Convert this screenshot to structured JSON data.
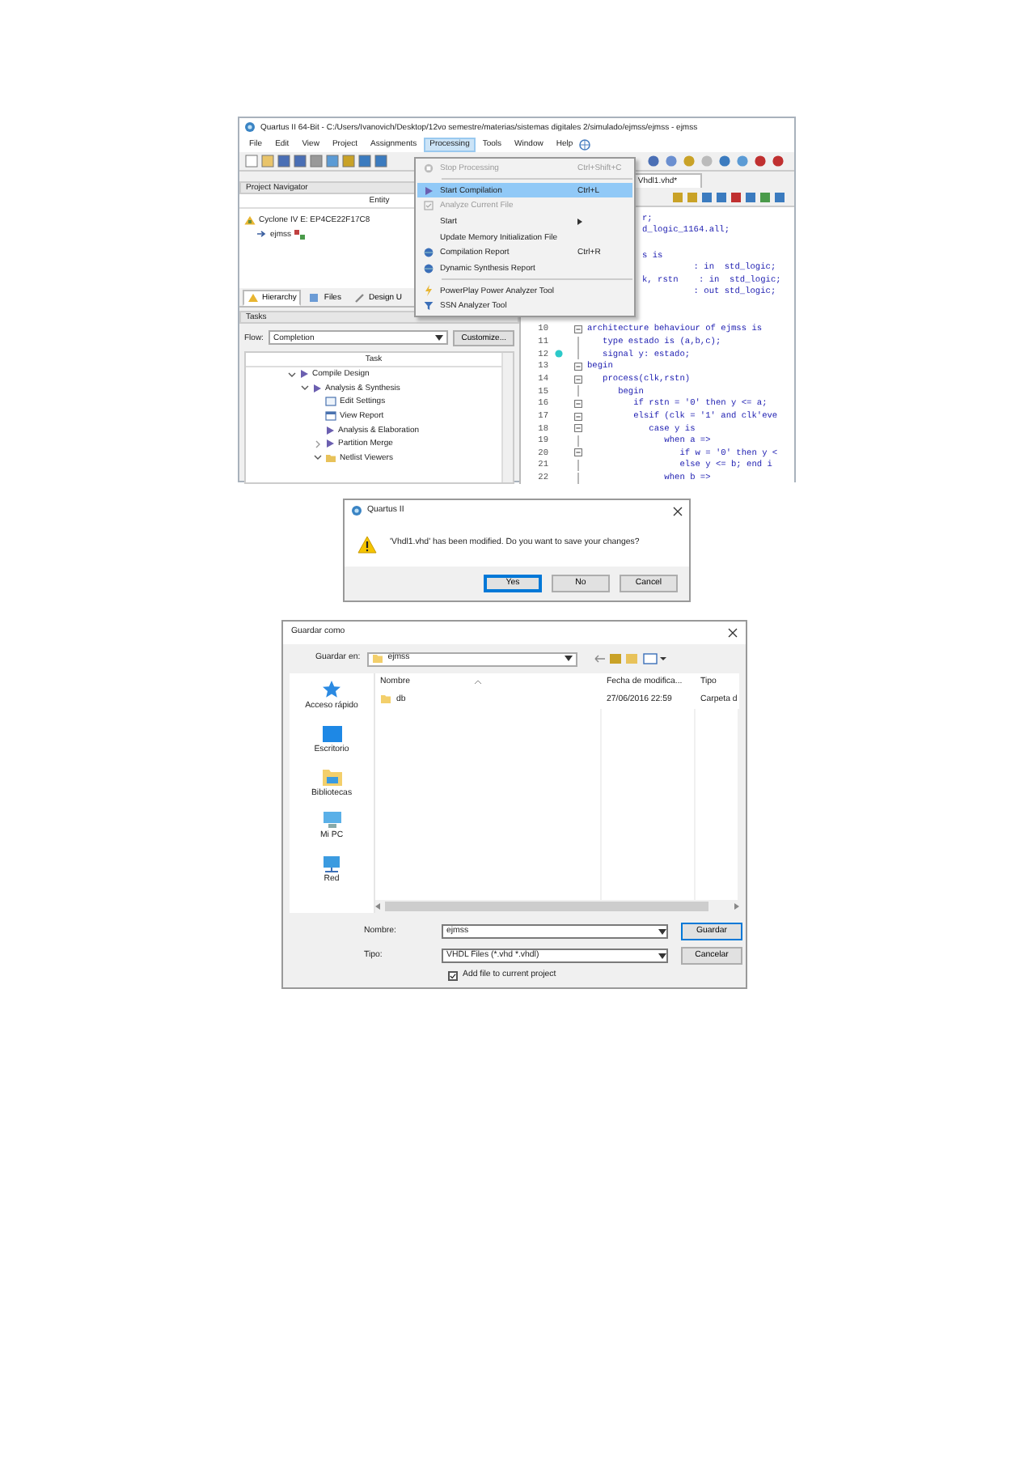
{
  "editor_window": {
    "title": "Quartus II 64-Bit - C:/Users/Ivanovich/Desktop/12vo semestre/materias/sistemas digitales 2/simulado/ejmss/ejmss - ejmss",
    "menu": [
      {
        "label": "File",
        "selected": false
      },
      {
        "label": "Edit",
        "selected": false
      },
      {
        "label": "View",
        "selected": false
      },
      {
        "label": "Project",
        "selected": false
      },
      {
        "label": "Assignments",
        "selected": false
      },
      {
        "label": "Processing",
        "selected": true
      },
      {
        "label": "Tools",
        "selected": false
      },
      {
        "label": "Window",
        "selected": false
      },
      {
        "label": "Help",
        "selected": false
      }
    ],
    "project_navigator": {
      "title": "Project Navigator",
      "column": "Entity",
      "tree": [
        {
          "label": "Cyclone IV E: EP4CE22F17C8",
          "children": [
            {
              "label": "ejmss"
            }
          ]
        }
      ],
      "tabs": [
        {
          "label": "Hierarchy",
          "selected": true
        },
        {
          "label": "Files",
          "selected": false
        },
        {
          "label": "Design U",
          "selected": false
        }
      ]
    },
    "tasks": {
      "title": "Tasks",
      "flow_label": "Flow:",
      "flow_value": "Completion",
      "customize_button": "Customize...",
      "column": "Task",
      "tree": [
        {
          "label": "Compile Design",
          "kind": "run",
          "expanded": true,
          "children": [
            {
              "label": "Analysis & Synthesis",
              "kind": "run",
              "expanded": true,
              "children": [
                {
                  "label": "Edit Settings",
                  "kind": "settings"
                },
                {
                  "label": "View Report",
                  "kind": "report"
                },
                {
                  "label": "Analysis & Elaboration",
                  "kind": "run"
                },
                {
                  "label": "Partition Merge",
                  "kind": "run",
                  "expanded": false
                },
                {
                  "label": "Netlist Viewers",
                  "kind": "folder",
                  "expanded": true
                }
              ]
            }
          ]
        }
      ]
    },
    "editor": {
      "tab": "Vhdl1.vhd*",
      "lines": [
        {
          "kind": "fragment",
          "text": "r;"
        },
        {
          "kind": "fragment",
          "text": "d_logic_1164.all;"
        },
        {
          "kind": "blank"
        },
        {
          "kind": "fragment",
          "text": "s is"
        },
        {
          "kind": "fragment",
          "text": "          : in  std_logic;"
        },
        {
          "kind": "fragment",
          "text": "k, rstn    : in  std_logic;"
        },
        {
          "kind": "fragment",
          "text": "          : out std_logic;"
        },
        {
          "kind": "blank"
        },
        {
          "kind": "blank"
        },
        {
          "kind": "line",
          "number": "10",
          "fold": true,
          "marked": false,
          "text": "architecture behaviour of ejmss is"
        },
        {
          "kind": "line",
          "number": "11",
          "fold": false,
          "marked": false,
          "text": "   type estado is (a,b,c);"
        },
        {
          "kind": "line",
          "number": "12",
          "fold": false,
          "marked": true,
          "text": "   signal y: estado;"
        },
        {
          "kind": "line",
          "number": "13",
          "fold": true,
          "marked": false,
          "text": "begin"
        },
        {
          "kind": "line",
          "number": "14",
          "fold": true,
          "marked": false,
          "text": "   process(clk,rstn)"
        },
        {
          "kind": "line",
          "number": "15",
          "fold": false,
          "marked": false,
          "text": "      begin"
        },
        {
          "kind": "line",
          "number": "16",
          "fold": true,
          "marked": false,
          "text": "         if rstn = '0' then y <= a;"
        },
        {
          "kind": "line",
          "number": "17",
          "fold": true,
          "marked": false,
          "text": "         elsif (clk = '1' and clk'eve"
        },
        {
          "kind": "line",
          "number": "18",
          "fold": true,
          "marked": false,
          "text": "            case y is"
        },
        {
          "kind": "line",
          "number": "19",
          "fold": false,
          "marked": false,
          "text": "               when a =>"
        },
        {
          "kind": "line",
          "number": "20",
          "fold": true,
          "marked": false,
          "text": "                  if w = '0' then y <"
        },
        {
          "kind": "line",
          "number": "21",
          "fold": false,
          "marked": false,
          "text": "                  else y <= b; end i"
        },
        {
          "kind": "line",
          "number": "22",
          "fold": false,
          "marked": false,
          "text": "               when b =>"
        }
      ]
    },
    "processing_menu": [
      {
        "label": "Stop Processing",
        "shortcut": "Ctrl+Shift+C",
        "kind": "stop",
        "disabled": true,
        "selected": false,
        "separator_after": true
      },
      {
        "label": "Start Compilation",
        "shortcut": "Ctrl+L",
        "kind": "compile",
        "disabled": false,
        "selected": true,
        "separator_after": false
      },
      {
        "label": "Analyze Current File",
        "kind": "analyze",
        "disabled": true,
        "selected": false,
        "separator_after": false
      },
      {
        "label": "Start",
        "kind": "submenu",
        "disabled": false,
        "selected": false,
        "separator_after": false
      },
      {
        "label": "Update Memory Initialization File",
        "kind": "plain",
        "disabled": false,
        "selected": false,
        "separator_after": false
      },
      {
        "label": "Compilation Report",
        "shortcut": "Ctrl+R",
        "kind": "report",
        "disabled": false,
        "selected": false,
        "separator_after": false
      },
      {
        "label": "Dynamic Synthesis Report",
        "kind": "report",
        "disabled": false,
        "selected": false,
        "separator_after": true
      },
      {
        "label": "PowerPlay Power Analyzer Tool",
        "kind": "power",
        "disabled": false,
        "selected": false,
        "separator_after": false
      },
      {
        "label": "SSN Analyzer Tool",
        "kind": "ssn",
        "disabled": false,
        "selected": false,
        "separator_after": false
      }
    ]
  },
  "save_prompt": {
    "title": "Quartus II",
    "message": "'Vhdl1.vhd' has been modified. Do you want to save your changes?",
    "buttons": [
      {
        "label": "Yes",
        "default": true
      },
      {
        "label": "No",
        "default": false
      },
      {
        "label": "Cancel",
        "default": false
      }
    ]
  },
  "save_dialog": {
    "title": "Guardar como",
    "save_in_label": "Guardar en:",
    "save_in_value": "ejmss",
    "places": [
      {
        "label": "Acceso rápido",
        "kind": "quick"
      },
      {
        "label": "Escritorio",
        "kind": "desktop"
      },
      {
        "label": "Bibliotecas",
        "kind": "libraries"
      },
      {
        "label": "Mi PC",
        "kind": "pc"
      },
      {
        "label": "Red",
        "kind": "network"
      }
    ],
    "columns": [
      "Nombre",
      "Fecha de modifica...",
      "Tipo"
    ],
    "files": [
      {
        "name": "db",
        "date": "27/06/2016 22:59",
        "type": "Carpeta d"
      }
    ],
    "filename_label": "Nombre:",
    "filename": "ejmss",
    "type_label": "Tipo:",
    "type_value": "VHDL Files (*.vhd *.vhdl)",
    "save_button": "Guardar",
    "cancel_button": "Cancelar",
    "add_to_project": {
      "label": "Add file to current project",
      "checked": true
    }
  }
}
